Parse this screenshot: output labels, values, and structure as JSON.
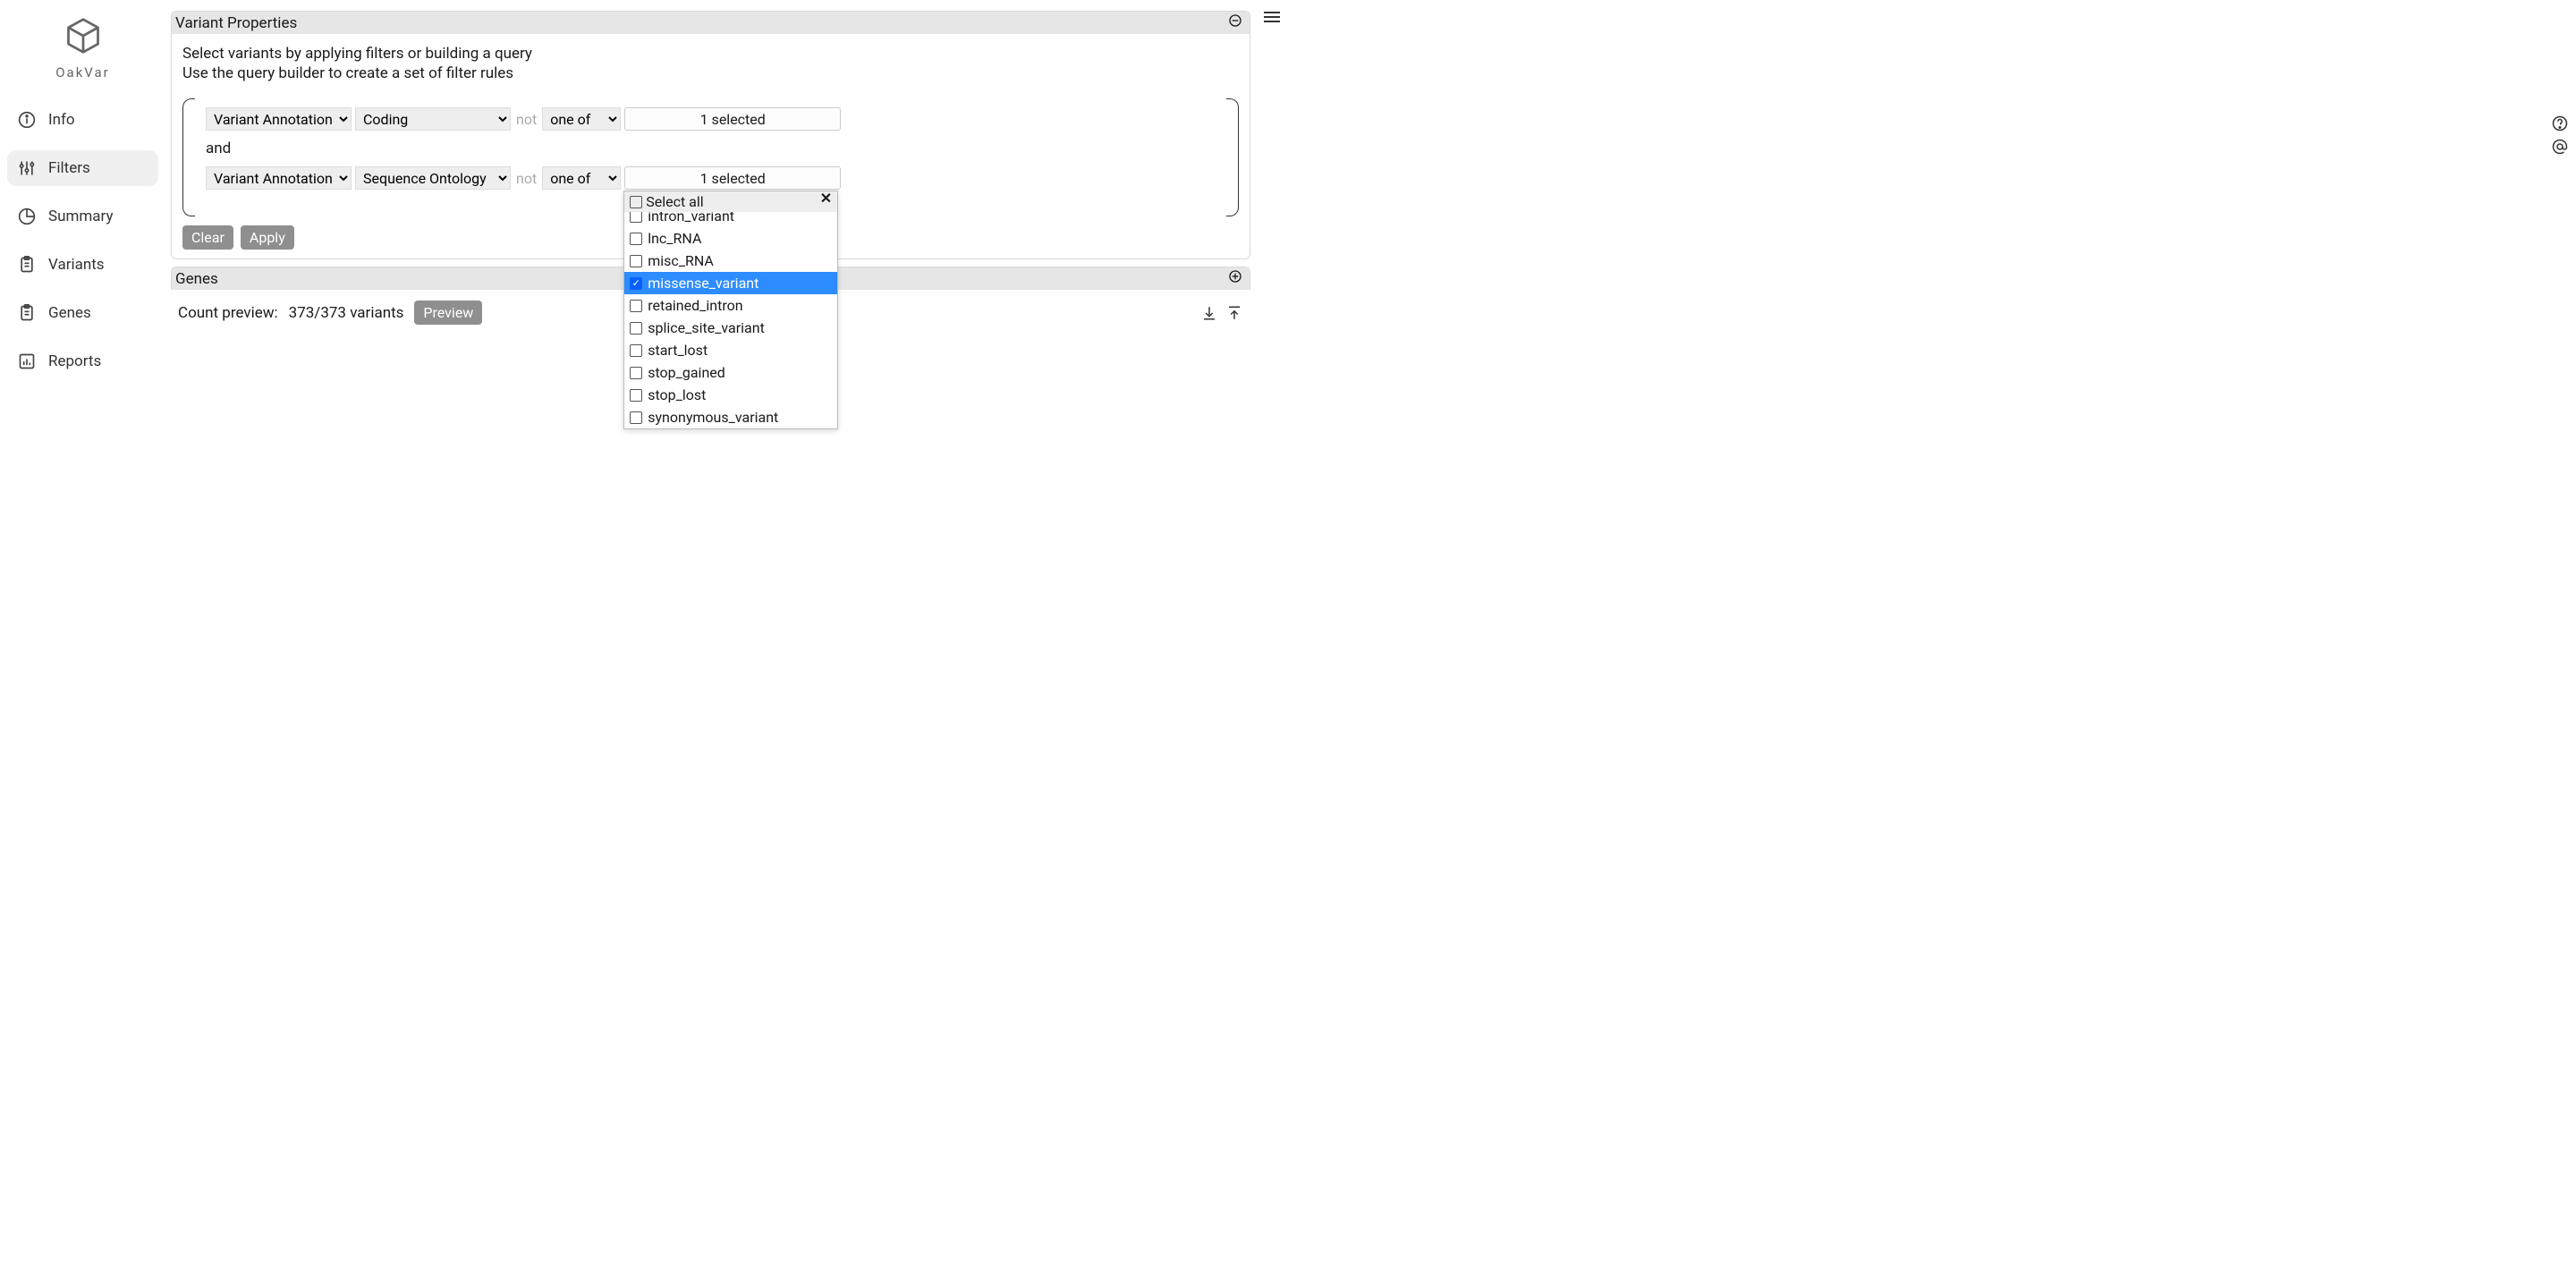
{
  "brand": {
    "name": "OakVar"
  },
  "nav": {
    "items": [
      {
        "id": "info",
        "label": "Info"
      },
      {
        "id": "filters",
        "label": "Filters"
      },
      {
        "id": "summary",
        "label": "Summary"
      },
      {
        "id": "variants",
        "label": "Variants"
      },
      {
        "id": "genes",
        "label": "Genes"
      },
      {
        "id": "reports",
        "label": "Reports"
      }
    ],
    "active": "filters"
  },
  "panels": {
    "variant_properties": {
      "title": "Variant Properties",
      "intro1": "Select variants by applying filters or building a query",
      "intro2": "Use the query builder to create a set of filter rules",
      "joiner": "and",
      "not_label": "not",
      "clear_label": "Clear",
      "apply_label": "Apply",
      "rows": [
        {
          "source": "Variant Annotation",
          "column": "Coding",
          "op": "one of",
          "summary": "1 selected"
        },
        {
          "source": "Variant Annotation",
          "column": "Sequence Ontology",
          "op": "one of",
          "summary": "1 selected"
        }
      ]
    },
    "genes": {
      "title": "Genes"
    },
    "count_preview": {
      "label": "Count preview:",
      "value": "373/373 variants",
      "preview_btn": "Preview"
    }
  },
  "dropdown": {
    "select_all": "Select all",
    "options": [
      {
        "value": "intron_variant",
        "checked": false,
        "partial": true
      },
      {
        "value": "lnc_RNA",
        "checked": false
      },
      {
        "value": "misc_RNA",
        "checked": false
      },
      {
        "value": "missense_variant",
        "checked": true,
        "selected": true
      },
      {
        "value": "retained_intron",
        "checked": false
      },
      {
        "value": "splice_site_variant",
        "checked": false
      },
      {
        "value": "start_lost",
        "checked": false
      },
      {
        "value": "stop_gained",
        "checked": false
      },
      {
        "value": "stop_lost",
        "checked": false
      },
      {
        "value": "synonymous_variant",
        "checked": false
      }
    ]
  }
}
